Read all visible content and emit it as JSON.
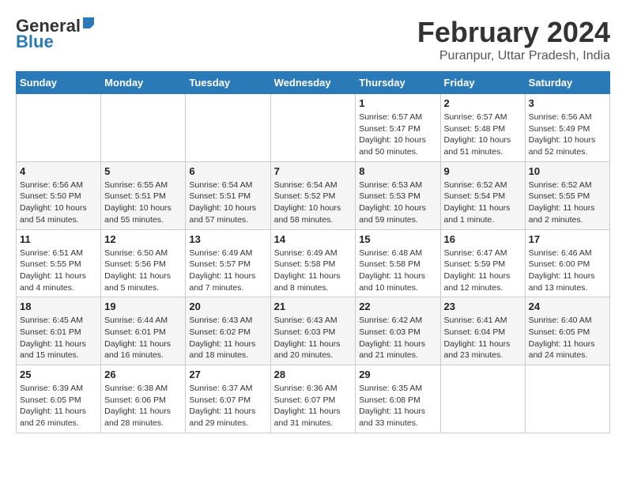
{
  "logo": {
    "general": "General",
    "blue": "Blue"
  },
  "header": {
    "title": "February 2024",
    "subtitle": "Puranpur, Uttar Pradesh, India"
  },
  "days_of_week": [
    "Sunday",
    "Monday",
    "Tuesday",
    "Wednesday",
    "Thursday",
    "Friday",
    "Saturday"
  ],
  "weeks": [
    [
      {
        "day": "",
        "info": ""
      },
      {
        "day": "",
        "info": ""
      },
      {
        "day": "",
        "info": ""
      },
      {
        "day": "",
        "info": ""
      },
      {
        "day": "1",
        "info": "Sunrise: 6:57 AM\nSunset: 5:47 PM\nDaylight: 10 hours\nand 50 minutes."
      },
      {
        "day": "2",
        "info": "Sunrise: 6:57 AM\nSunset: 5:48 PM\nDaylight: 10 hours\nand 51 minutes."
      },
      {
        "day": "3",
        "info": "Sunrise: 6:56 AM\nSunset: 5:49 PM\nDaylight: 10 hours\nand 52 minutes."
      }
    ],
    [
      {
        "day": "4",
        "info": "Sunrise: 6:56 AM\nSunset: 5:50 PM\nDaylight: 10 hours\nand 54 minutes."
      },
      {
        "day": "5",
        "info": "Sunrise: 6:55 AM\nSunset: 5:51 PM\nDaylight: 10 hours\nand 55 minutes."
      },
      {
        "day": "6",
        "info": "Sunrise: 6:54 AM\nSunset: 5:51 PM\nDaylight: 10 hours\nand 57 minutes."
      },
      {
        "day": "7",
        "info": "Sunrise: 6:54 AM\nSunset: 5:52 PM\nDaylight: 10 hours\nand 58 minutes."
      },
      {
        "day": "8",
        "info": "Sunrise: 6:53 AM\nSunset: 5:53 PM\nDaylight: 10 hours\nand 59 minutes."
      },
      {
        "day": "9",
        "info": "Sunrise: 6:52 AM\nSunset: 5:54 PM\nDaylight: 11 hours\nand 1 minute."
      },
      {
        "day": "10",
        "info": "Sunrise: 6:52 AM\nSunset: 5:55 PM\nDaylight: 11 hours\nand 2 minutes."
      }
    ],
    [
      {
        "day": "11",
        "info": "Sunrise: 6:51 AM\nSunset: 5:55 PM\nDaylight: 11 hours\nand 4 minutes."
      },
      {
        "day": "12",
        "info": "Sunrise: 6:50 AM\nSunset: 5:56 PM\nDaylight: 11 hours\nand 5 minutes."
      },
      {
        "day": "13",
        "info": "Sunrise: 6:49 AM\nSunset: 5:57 PM\nDaylight: 11 hours\nand 7 minutes."
      },
      {
        "day": "14",
        "info": "Sunrise: 6:49 AM\nSunset: 5:58 PM\nDaylight: 11 hours\nand 8 minutes."
      },
      {
        "day": "15",
        "info": "Sunrise: 6:48 AM\nSunset: 5:58 PM\nDaylight: 11 hours\nand 10 minutes."
      },
      {
        "day": "16",
        "info": "Sunrise: 6:47 AM\nSunset: 5:59 PM\nDaylight: 11 hours\nand 12 minutes."
      },
      {
        "day": "17",
        "info": "Sunrise: 6:46 AM\nSunset: 6:00 PM\nDaylight: 11 hours\nand 13 minutes."
      }
    ],
    [
      {
        "day": "18",
        "info": "Sunrise: 6:45 AM\nSunset: 6:01 PM\nDaylight: 11 hours\nand 15 minutes."
      },
      {
        "day": "19",
        "info": "Sunrise: 6:44 AM\nSunset: 6:01 PM\nDaylight: 11 hours\nand 16 minutes."
      },
      {
        "day": "20",
        "info": "Sunrise: 6:43 AM\nSunset: 6:02 PM\nDaylight: 11 hours\nand 18 minutes."
      },
      {
        "day": "21",
        "info": "Sunrise: 6:43 AM\nSunset: 6:03 PM\nDaylight: 11 hours\nand 20 minutes."
      },
      {
        "day": "22",
        "info": "Sunrise: 6:42 AM\nSunset: 6:03 PM\nDaylight: 11 hours\nand 21 minutes."
      },
      {
        "day": "23",
        "info": "Sunrise: 6:41 AM\nSunset: 6:04 PM\nDaylight: 11 hours\nand 23 minutes."
      },
      {
        "day": "24",
        "info": "Sunrise: 6:40 AM\nSunset: 6:05 PM\nDaylight: 11 hours\nand 24 minutes."
      }
    ],
    [
      {
        "day": "25",
        "info": "Sunrise: 6:39 AM\nSunset: 6:05 PM\nDaylight: 11 hours\nand 26 minutes."
      },
      {
        "day": "26",
        "info": "Sunrise: 6:38 AM\nSunset: 6:06 PM\nDaylight: 11 hours\nand 28 minutes."
      },
      {
        "day": "27",
        "info": "Sunrise: 6:37 AM\nSunset: 6:07 PM\nDaylight: 11 hours\nand 29 minutes."
      },
      {
        "day": "28",
        "info": "Sunrise: 6:36 AM\nSunset: 6:07 PM\nDaylight: 11 hours\nand 31 minutes."
      },
      {
        "day": "29",
        "info": "Sunrise: 6:35 AM\nSunset: 6:08 PM\nDaylight: 11 hours\nand 33 minutes."
      },
      {
        "day": "",
        "info": ""
      },
      {
        "day": "",
        "info": ""
      }
    ]
  ]
}
